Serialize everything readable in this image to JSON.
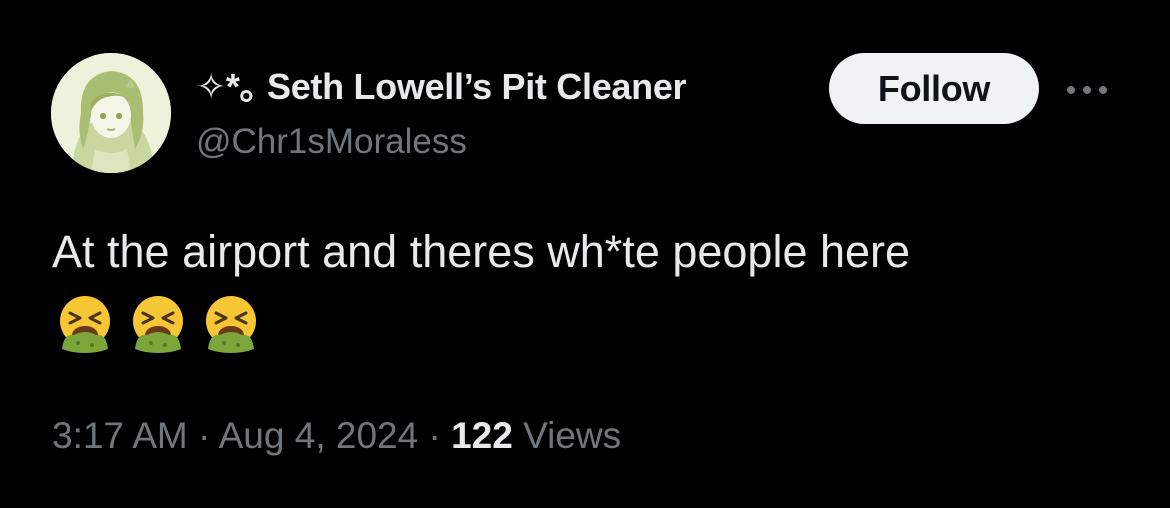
{
  "post": {
    "author": {
      "display_name": "✧*｡ Seth Lowell’s Pit Cleaner",
      "handle": "@Chr1sMoraless",
      "avatar_icon": "anime-character-avatar"
    },
    "follow_label": "Follow",
    "more_icon": "more-options-icon",
    "text": "At the airport and theres wh*te people here",
    "emojis": [
      "face-vomiting-emoji",
      "face-vomiting-emoji",
      "face-vomiting-emoji"
    ],
    "time": "3:17 AM",
    "date": "Aug 4, 2024",
    "separator": "·",
    "views_count": "122",
    "views_label": "Views"
  },
  "colors": {
    "background": "#000000",
    "primary_text": "#e7e9ea",
    "secondary_text": "#71767b",
    "follow_button_bg": "#eff3f4",
    "follow_button_text": "#0f1419"
  }
}
